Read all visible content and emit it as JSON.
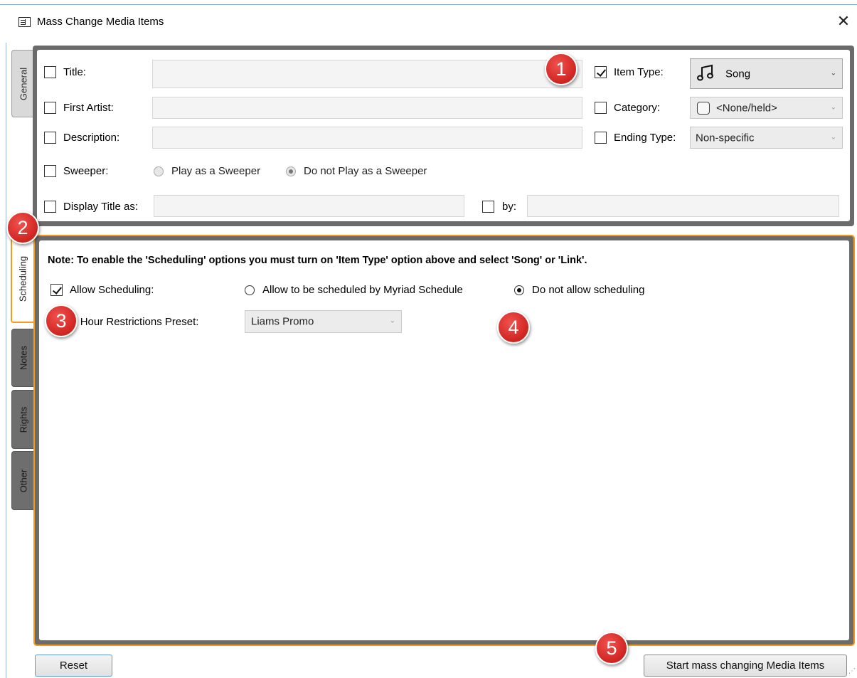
{
  "window": {
    "title": "Mass Change Media Items",
    "close_glyph": "✕"
  },
  "tabs": [
    {
      "label": "General"
    },
    {
      "label": "Scheduling"
    },
    {
      "label": "Notes"
    },
    {
      "label": "Rights"
    },
    {
      "label": "Other"
    }
  ],
  "general": {
    "title_label": "Title:",
    "first_artist_label": "First Artist:",
    "description_label": "Description:",
    "sweeper_label": "Sweeper:",
    "sweeper_option_play": "Play as a Sweeper",
    "sweeper_option_no_play": "Do not Play as a Sweeper",
    "display_title_label": "Display Title as:",
    "by_label": "by:",
    "item_type_label": "Item Type:",
    "item_type_value": "Song",
    "item_type_checked": true,
    "category_label": "Category:",
    "category_value": "<None/held>",
    "ending_type_label": "Ending Type:",
    "ending_type_value": "Non-specific",
    "selected_sweeper_option": "Do not Play as a Sweeper"
  },
  "scheduling": {
    "note": "Note: To enable the 'Scheduling' options you must turn on 'Item Type' option above and select 'Song' or 'Link'.",
    "allow_label": "Allow Scheduling:",
    "allow_checked": true,
    "option_allow": "Allow to be scheduled by Myriad Schedule",
    "option_disallow": "Do not allow scheduling",
    "selected_option": "Do not allow scheduling",
    "hour_restrictions_label": "Apply Hour Restrictions Preset:",
    "hour_restrictions_value": "Liams Promo"
  },
  "buttons": {
    "reset": "Reset",
    "start": "Start mass changing Media Items"
  },
  "badges": [
    "1",
    "2",
    "3",
    "4",
    "5"
  ],
  "colors": {
    "accent_orange": "#f59a1b",
    "badge_red": "#d92b27",
    "panel_gray": "#6b6b6b"
  },
  "icons": {
    "item_type_icon": "music-note-icon",
    "category_icon": "color-swatch-icon"
  }
}
